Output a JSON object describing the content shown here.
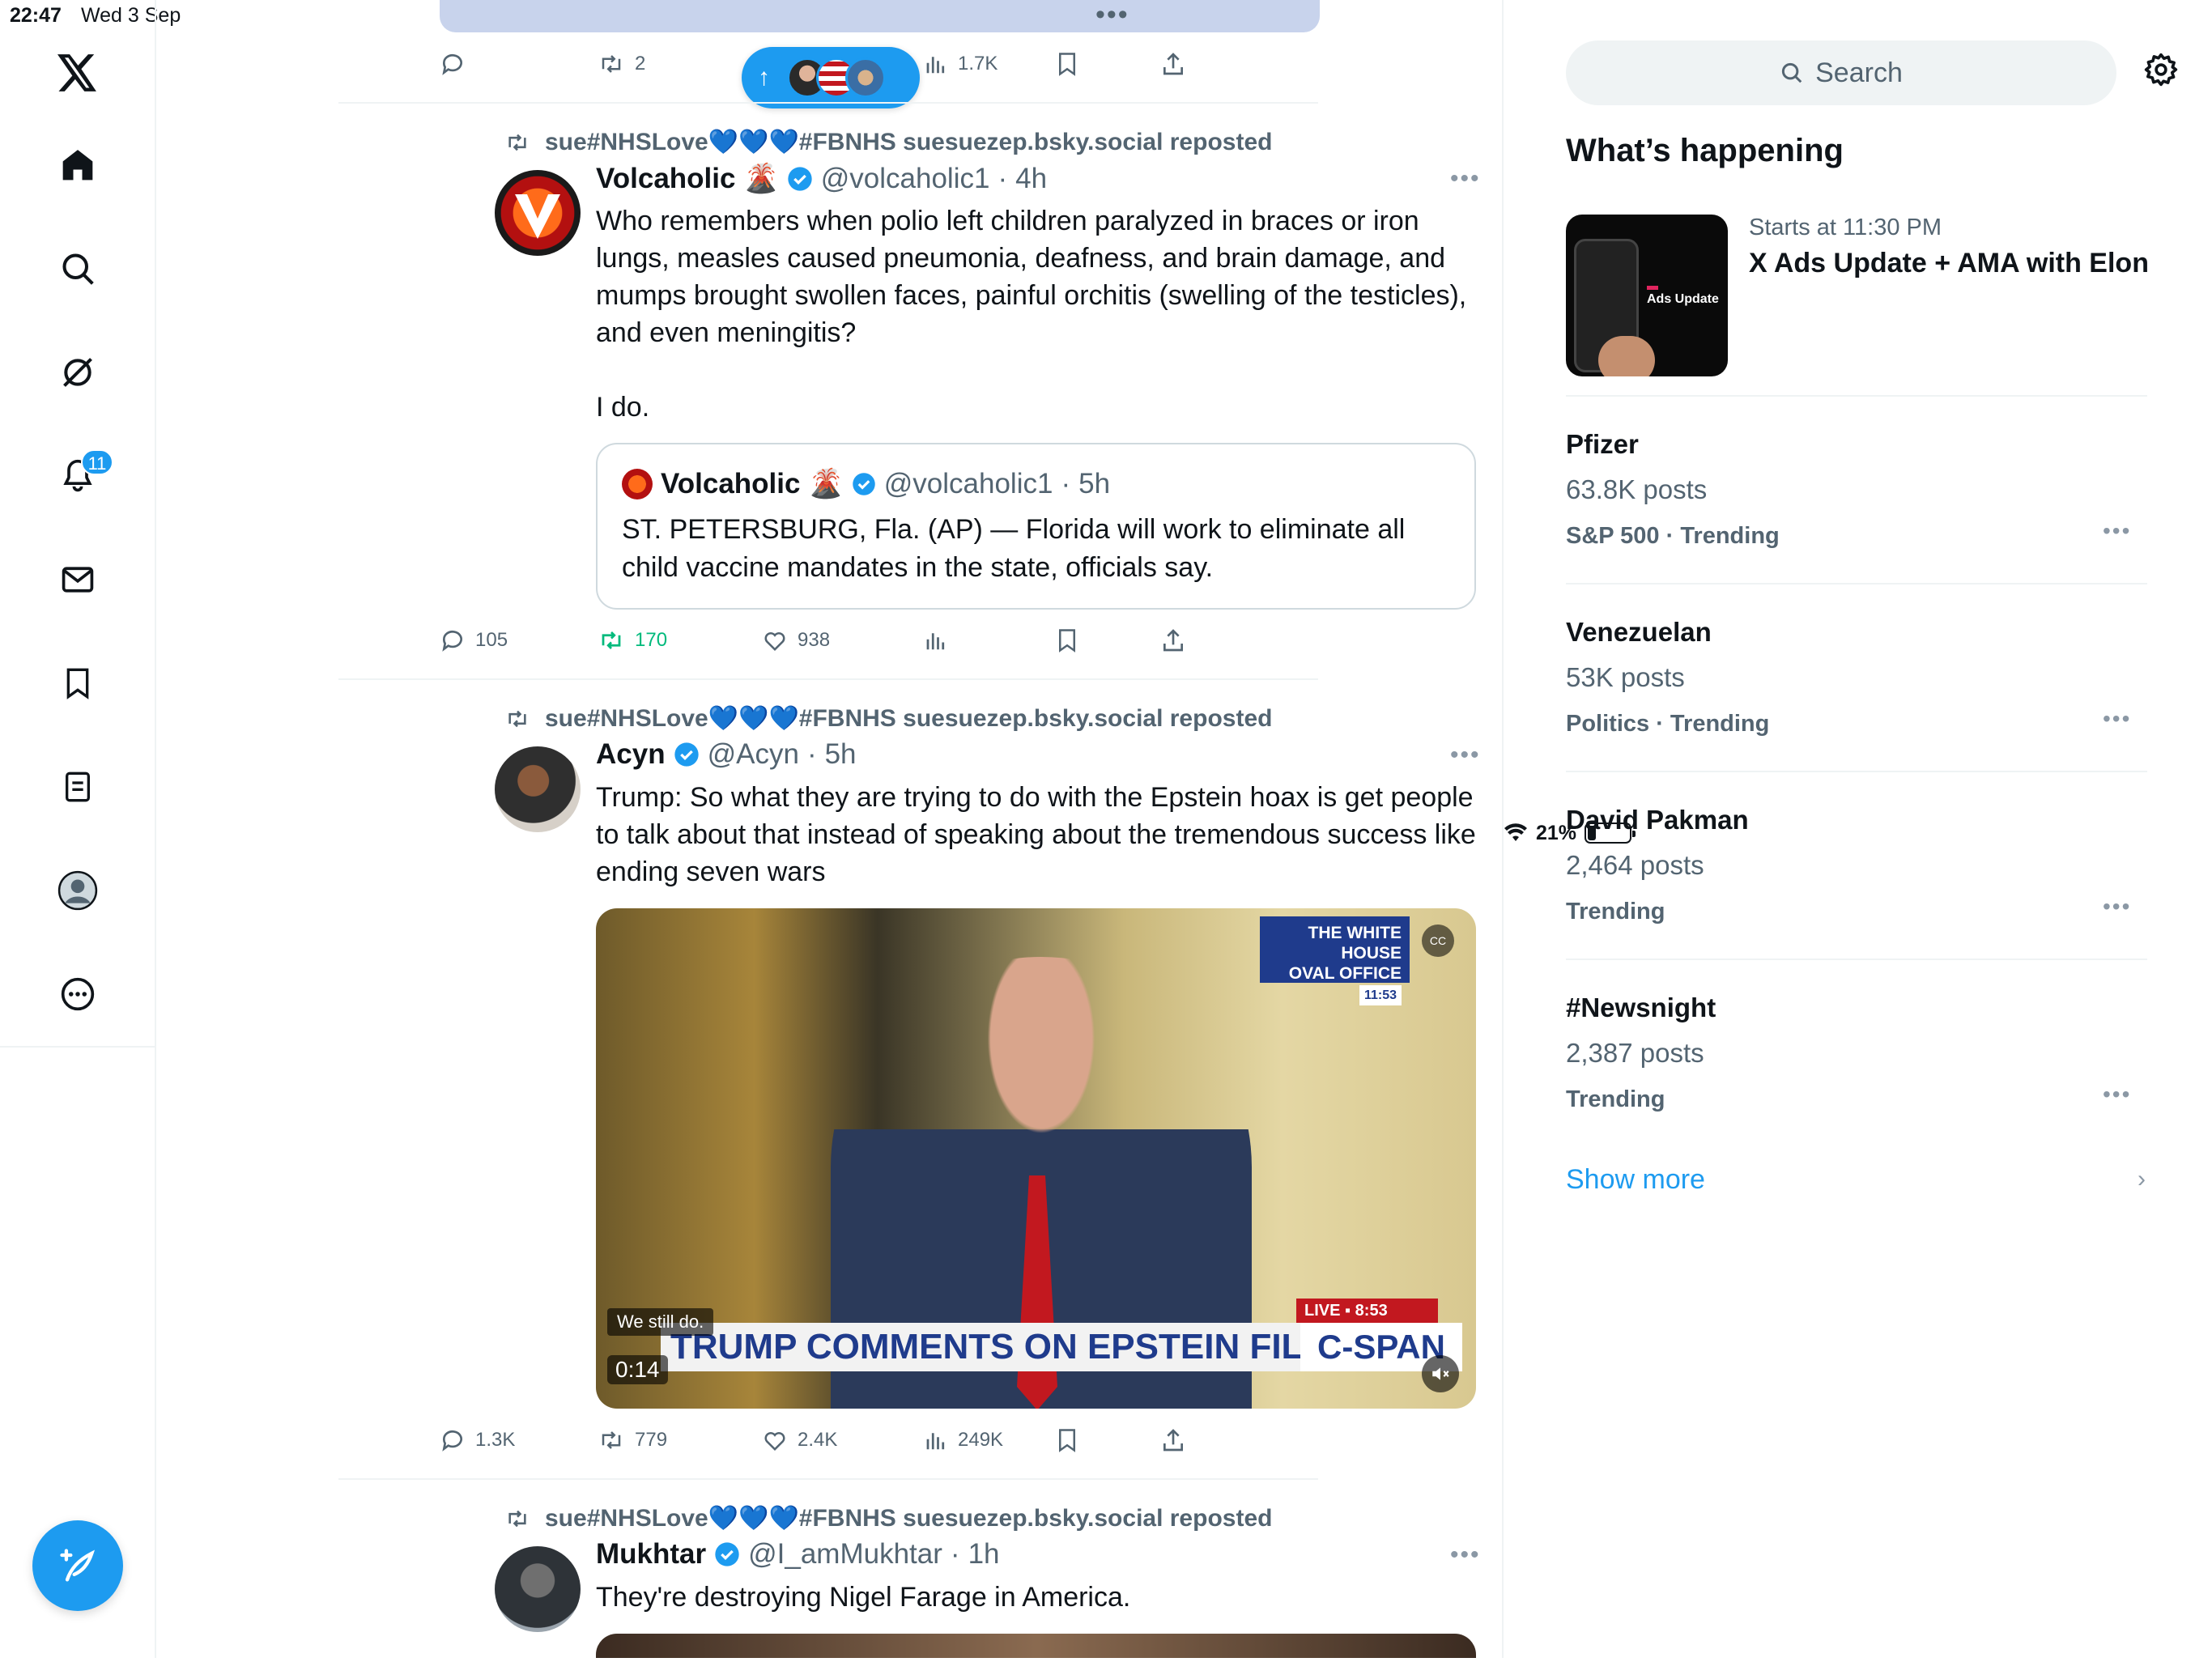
{
  "status_bar": {
    "time": "22:47",
    "date": "Wed 3 Sep",
    "battery": "21%"
  },
  "nav": {
    "notifications_count": "11"
  },
  "top_tweet": {
    "replies": "",
    "reposts": "2",
    "views": "1.7K"
  },
  "tweets": [
    {
      "repost_line": "sue#NHSLove💙💙💙#FBNHS suesuezep.bsky.social reposted",
      "name": "Volcaholic 🌋",
      "handle": "@volcaholic1",
      "time": "4h",
      "text": "Who remembers when polio left children paralyzed in braces or iron lungs, measles caused pneumonia, deafness, and brain damage, and mumps brought swollen faces, painful orchitis (swelling of the testicles), and even meningitis?\n\nI do.",
      "quote": {
        "name": "Volcaholic 🌋",
        "handle": "@volcaholic1",
        "time": "5h",
        "text": "ST. PETERSBURG, Fla. (AP) — Florida will work to eliminate all child vaccine mandates in the state, officials say."
      },
      "stats": {
        "replies": "105",
        "reposts": "170",
        "likes": "938"
      }
    },
    {
      "repost_line": "sue#NHSLove💙💙💙#FBNHS suesuezep.bsky.social reposted",
      "name": "Acyn",
      "handle": "@Acyn",
      "time": "5h",
      "text": "Trump: So what they are trying to do with the Epstein hoax is get people to talk about that instead of speaking about the tremendous success like ending seven wars",
      "video": {
        "chyron": "TRUMP COMMENTS ON EPSTEIN FILES",
        "network": "C-SPAN",
        "live_label": "LIVE ▪ 8:53",
        "location_line1": "THE WHITE HOUSE",
        "location_line2": "OVAL OFFICE",
        "location_time": "11:53",
        "caption": "We still do.",
        "duration": "0:14"
      },
      "stats": {
        "replies": "1.3K",
        "reposts": "779",
        "likes": "2.4K",
        "views": "249K"
      }
    },
    {
      "repost_line": "sue#NHSLove💙💙💙#FBNHS suesuezep.bsky.social reposted",
      "name": "Mukhtar",
      "handle": "@I_amMukhtar",
      "time": "1h",
      "text": "They're destroying Nigel Farage in America."
    }
  ],
  "sidebar": {
    "search_placeholder": "Search",
    "whats_happening": "What’s happening",
    "event": {
      "subtitle": "Starts at 11:30 PM",
      "title": "X Ads Update + AMA with Elon",
      "image_label": "Ads Update"
    },
    "trends": [
      {
        "name": "Pfizer",
        "posts": "63.8K posts",
        "meta": "S&P 500 · Trending"
      },
      {
        "name": "Venezuelan",
        "posts": "53K posts",
        "meta": "Politics · Trending"
      },
      {
        "name": "David Pakman",
        "posts": "2,464 posts",
        "meta": "Trending"
      },
      {
        "name": "#Newsnight",
        "posts": "2,387 posts",
        "meta": "Trending"
      }
    ],
    "show_more": "Show more"
  },
  "colors": {
    "accent": "#1d9bf0",
    "repost_green": "#00ba7c",
    "muted": "#536471",
    "border": "#eff3f4"
  }
}
